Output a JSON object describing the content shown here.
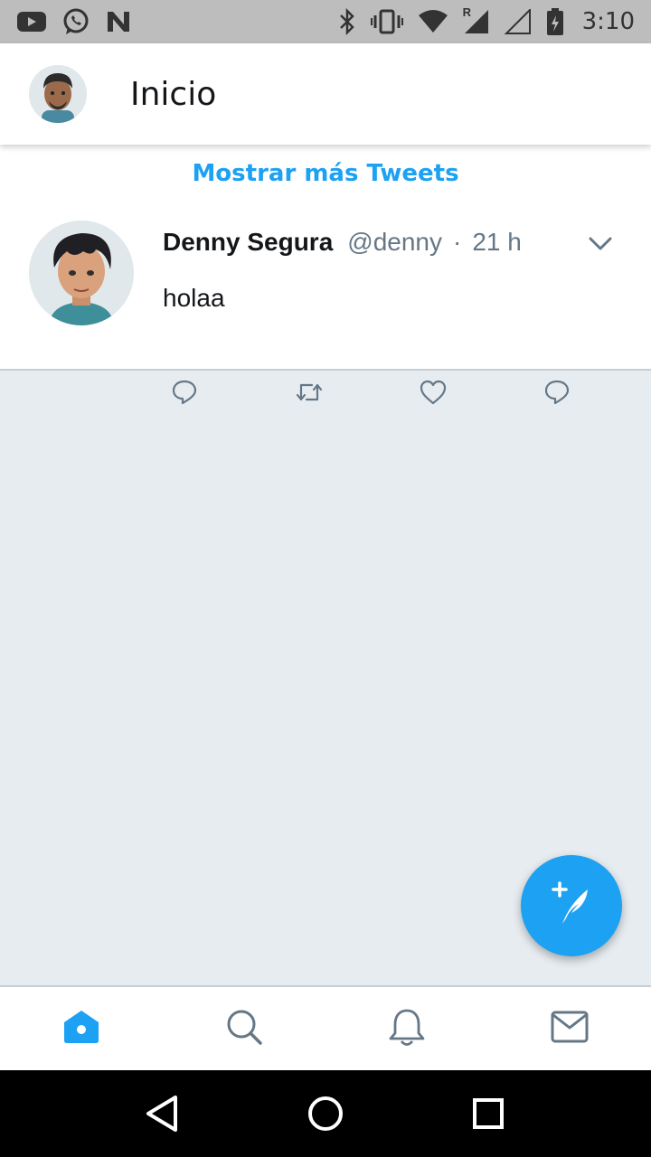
{
  "status_bar": {
    "time": "3:10",
    "left_icons": [
      "youtube-icon",
      "whatsapp-icon",
      "n-app-icon"
    ],
    "right_icons": [
      "bluetooth-icon",
      "vibrate-icon",
      "wifi-icon",
      "signal-icon",
      "signal-empty-icon",
      "battery-icon"
    ],
    "roaming_label": "R"
  },
  "header": {
    "title": "Inicio",
    "avatar_icon": "profile-avatar"
  },
  "timeline": {
    "show_more_label": "Mostrar más Tweets",
    "tweets": [
      {
        "name": "Denny Segura",
        "handle": "@denny",
        "separator": "·",
        "time": "21 h",
        "text": "holaa",
        "actions": [
          "reply-icon",
          "retweet-icon",
          "like-icon",
          "message-icon"
        ]
      }
    ]
  },
  "fab": {
    "icon": "compose-tweet-icon"
  },
  "tabs": [
    {
      "icon": "home-icon",
      "active": true
    },
    {
      "icon": "search-icon",
      "active": false
    },
    {
      "icon": "notifications-icon",
      "active": false
    },
    {
      "icon": "messages-icon",
      "active": false
    }
  ],
  "nav_bar": [
    "back-icon",
    "home-circle-icon",
    "recents-icon"
  ],
  "colors": {
    "accent": "#1da1f2",
    "background": "#e6ecf0",
    "text_primary": "#14171a",
    "text_secondary": "#657786",
    "status_bar": "#bdbdbd"
  }
}
